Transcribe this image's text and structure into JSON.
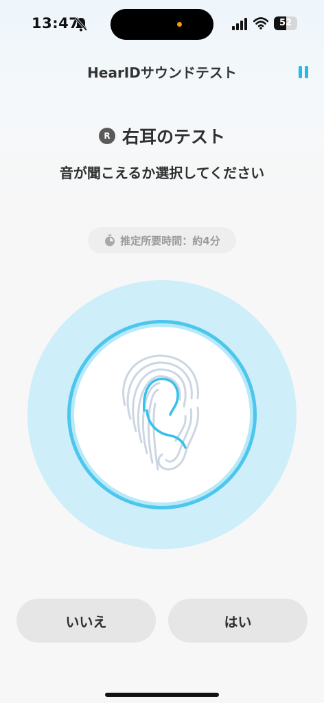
{
  "status_bar": {
    "time": "13:47",
    "battery_level": "52",
    "battery_fraction": 0.52,
    "icons": [
      "bell-slash-icon",
      "cellular-signal-icon",
      "wifi-icon",
      "battery-icon"
    ],
    "island_dot_color": "#f39c12"
  },
  "header": {
    "title": "HearIDサウンドテスト",
    "pause_icon": "pause-icon",
    "accent_color": "#29b8e8"
  },
  "test": {
    "ear_badge": "R",
    "ear_title": "右耳のテスト",
    "instruction": "音が聞こえるか選択してください",
    "estimated_time": "推定所要時間：約4分",
    "timer_icon": "timer-icon",
    "center_icon": "fingerprint-ear-icon"
  },
  "actions": {
    "no_label": "いいえ",
    "yes_label": "はい"
  }
}
